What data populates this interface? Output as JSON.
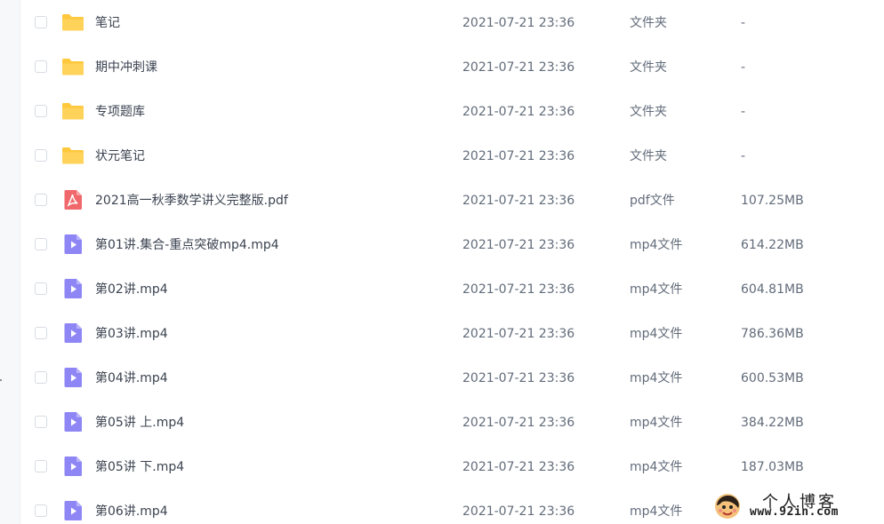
{
  "colors": {
    "folder": "#ffc83d",
    "pdf": "#f0686b",
    "video": "#8f86f5",
    "text": "#454d5a",
    "muted": "#626c7a",
    "checkbox_border": "#d7dbe2"
  },
  "file_list": {
    "rows": [
      {
        "name": "笔记",
        "time": "2021-07-21 23:36",
        "type": "文件夹",
        "size": "-",
        "icon": "folder-icon"
      },
      {
        "name": "期中冲刺课",
        "time": "2021-07-21 23:36",
        "type": "文件夹",
        "size": "-",
        "icon": "folder-icon"
      },
      {
        "name": "专项题库",
        "time": "2021-07-21 23:36",
        "type": "文件夹",
        "size": "-",
        "icon": "folder-icon"
      },
      {
        "name": "状元笔记",
        "time": "2021-07-21 23:36",
        "type": "文件夹",
        "size": "-",
        "icon": "folder-icon"
      },
      {
        "name": "2021高一秋季数学讲义完整版.pdf",
        "time": "2021-07-21 23:36",
        "type": "pdf文件",
        "size": "107.25MB",
        "icon": "pdf-icon"
      },
      {
        "name": "第01讲.集合-重点突破mp4.mp4",
        "time": "2021-07-21 23:36",
        "type": "mp4文件",
        "size": "614.22MB",
        "icon": "video-icon"
      },
      {
        "name": "第02讲.mp4",
        "time": "2021-07-21 23:36",
        "type": "mp4文件",
        "size": "604.81MB",
        "icon": "video-icon"
      },
      {
        "name": "第03讲.mp4",
        "time": "2021-07-21 23:36",
        "type": "mp4文件",
        "size": "786.36MB",
        "icon": "video-icon"
      },
      {
        "name": "第04讲.mp4",
        "time": "2021-07-21 23:36",
        "type": "mp4文件",
        "size": "600.53MB",
        "icon": "video-icon"
      },
      {
        "name": "第05讲 上.mp4",
        "time": "2021-07-21 23:36",
        "type": "mp4文件",
        "size": "384.22MB",
        "icon": "video-icon"
      },
      {
        "name": "第05讲 下.mp4",
        "time": "2021-07-21 23:36",
        "type": "mp4文件",
        "size": "187.03MB",
        "icon": "video-icon"
      },
      {
        "name": "第06讲.mp4",
        "time": "2021-07-21 23:36",
        "type": "mp4文件",
        "size": "",
        "icon": "video-icon"
      }
    ]
  },
  "watermark": {
    "title": "个人博客",
    "url": "www.92in.com"
  }
}
